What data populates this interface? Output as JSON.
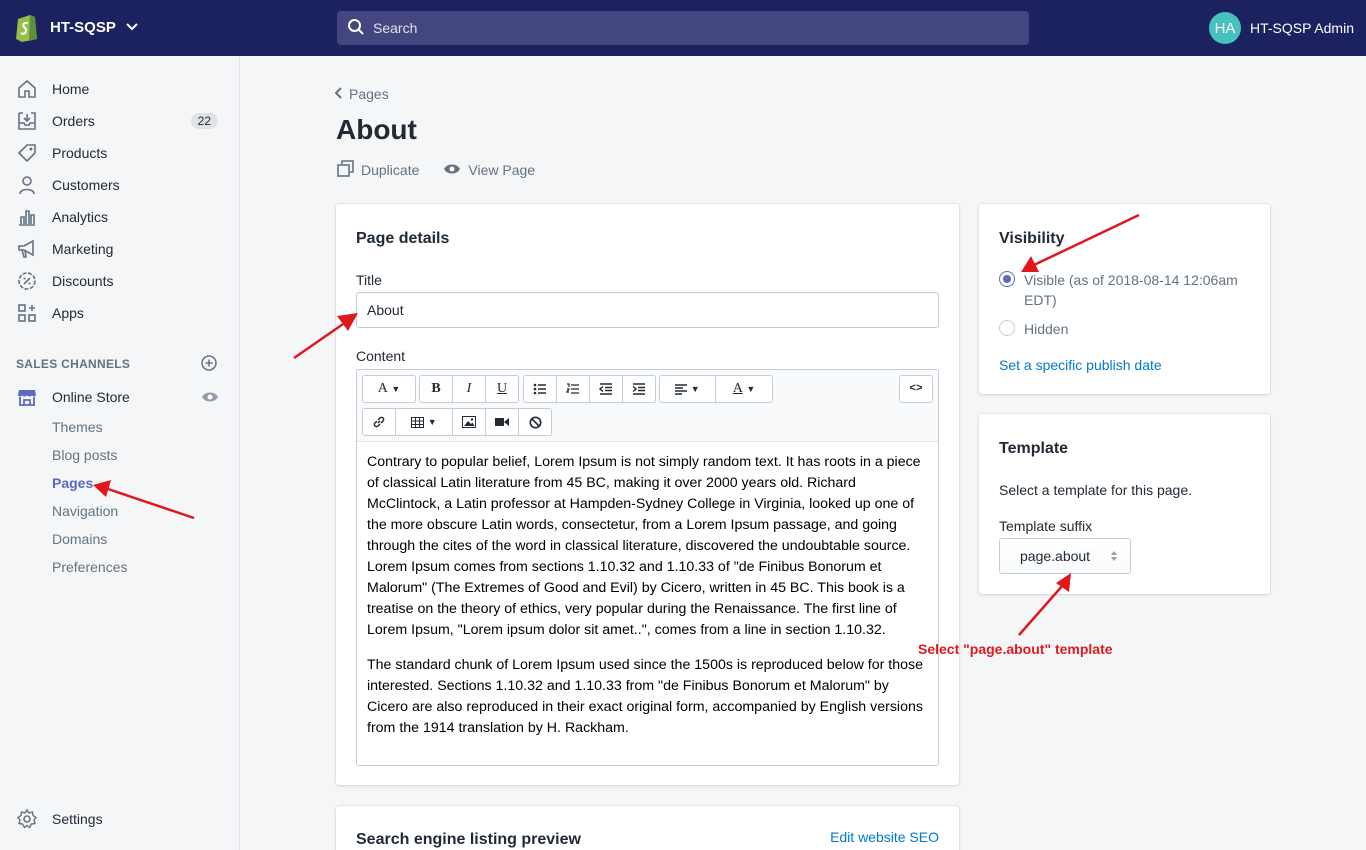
{
  "topbar": {
    "store_name": "HT-SQSP",
    "search_placeholder": "Search",
    "avatar_initials": "HA",
    "user_name": "HT-SQSP Admin"
  },
  "sidebar": {
    "items": [
      {
        "label": "Home",
        "icon": "home-icon"
      },
      {
        "label": "Orders",
        "icon": "orders-icon",
        "badge": "22"
      },
      {
        "label": "Products",
        "icon": "tag-icon"
      },
      {
        "label": "Customers",
        "icon": "person-icon"
      },
      {
        "label": "Analytics",
        "icon": "bar-chart-icon"
      },
      {
        "label": "Marketing",
        "icon": "megaphone-icon"
      },
      {
        "label": "Discounts",
        "icon": "discount-icon"
      },
      {
        "label": "Apps",
        "icon": "apps-icon"
      }
    ],
    "sales_channels_title": "SALES CHANNELS",
    "online_store": "Online Store",
    "sub_items": [
      "Themes",
      "Blog posts",
      "Pages",
      "Navigation",
      "Domains",
      "Preferences"
    ],
    "active_sub_item": "Pages",
    "settings": "Settings"
  },
  "main": {
    "breadcrumb": "Pages",
    "title": "About",
    "actions": {
      "duplicate": "Duplicate",
      "view_page": "View Page"
    },
    "page_details": {
      "heading": "Page details",
      "title_label": "Title",
      "title_value": "About",
      "content_label": "Content",
      "paragraphs": [
        "Contrary to popular belief, Lorem Ipsum is not simply random text. It has roots in a piece of classical Latin literature from 45 BC, making it over 2000 years old. Richard McClintock, a Latin professor at Hampden-Sydney College in Virginia, looked up one of the more obscure Latin words, consectetur, from a Lorem Ipsum passage, and going through the cites of the word in classical literature, discovered the undoubtable source. Lorem Ipsum comes from sections 1.10.32 and 1.10.33 of \"de Finibus Bonorum et Malorum\" (The Extremes of Good and Evil) by Cicero, written in 45 BC. This book is a treatise on the theory of ethics, very popular during the Renaissance. The first line of Lorem Ipsum, \"Lorem ipsum dolor sit amet..\", comes from a line in section 1.10.32.",
        "The standard chunk of Lorem Ipsum used since the 1500s is reproduced below for those interested. Sections 1.10.32 and 1.10.33 from \"de Finibus Bonorum et Malorum\" by Cicero are also reproduced in their exact original form, accompanied by English versions from the 1914 translation by H. Rackham."
      ]
    },
    "seo": {
      "heading": "Search engine listing preview",
      "edit_link": "Edit website SEO"
    }
  },
  "visibility": {
    "heading": "Visibility",
    "visible_label": "Visible (as of 2018-08-14 12:06am EDT)",
    "hidden_label": "Hidden",
    "selected": "visible",
    "publish_link": "Set a specific publish date"
  },
  "template": {
    "heading": "Template",
    "description": "Select a template for this page.",
    "suffix_label": "Template suffix",
    "suffix_value": "page.about"
  },
  "annotation": {
    "text": "Select \"page.about\" template",
    "color": "#e1171e"
  },
  "colors": {
    "topbar": "#1c2260",
    "accent": "#5c6ac4",
    "link": "#007ace"
  }
}
